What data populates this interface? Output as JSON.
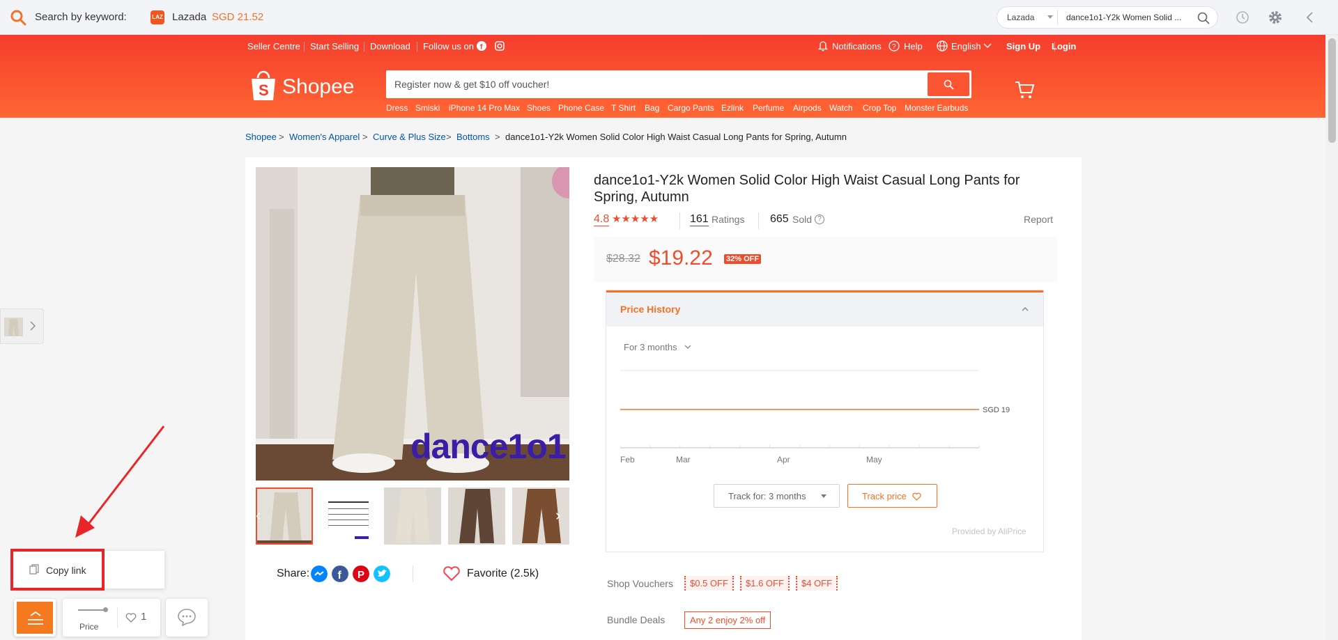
{
  "extension": {
    "search_label": "Search by keyword:",
    "lazada_icon_text": "LAZ",
    "lazada_name": "Lazada",
    "lazada_price": "SGD 21.52",
    "site_select": "Lazada",
    "query": "dance1o1-Y2k Women Solid ...",
    "accent": "#f57224"
  },
  "topnav": {
    "seller_centre": "Seller Centre",
    "start_selling": "Start Selling",
    "download": "Download",
    "follow_us": "Follow us on",
    "notifications": "Notifications",
    "help": "Help",
    "language": "English",
    "sign_up": "Sign Up",
    "login": "Login"
  },
  "header": {
    "logo_text": "Shopee",
    "search_placeholder": "Register now & get $10 off voucher!",
    "brand_color": "#ee4d2d",
    "keywords": [
      "Dress",
      "Smiski",
      "iPhone 14 Pro Max",
      "Shoes",
      "Phone Case",
      "T Shirt",
      "Bag",
      "Cargo Pants",
      "Ezlink",
      "Perfume",
      "Airpods",
      "Watch",
      "Crop Top",
      "Monster Earbuds"
    ]
  },
  "breadcrumb": [
    "Shopee",
    "Women's Apparel",
    "Curve & Plus Size",
    "Bottoms",
    "dance1o1-Y2k Women Solid Color High Waist Casual Long Pants for Spring, Autumn"
  ],
  "product": {
    "title": "dance1o1-Y2k Women Solid Color High Waist Casual Long Pants for Spring, Autumn",
    "rating": "4.8",
    "stars": "★★★★★",
    "ratings_count": "161",
    "ratings_label": "Ratings",
    "sold_count": "665",
    "sold_label": "Sold",
    "report": "Report",
    "old_price": "$28.32",
    "price": "$19.22",
    "discount": "32% OFF",
    "watermark": "dance1o1",
    "share_label": "Share:",
    "favorite": "Favorite (2.5k)"
  },
  "price_history": {
    "title": "Price History",
    "period": "For 3 months",
    "current_label": "SGD 19.22",
    "x_ticks": [
      "Feb",
      "Mar",
      "Apr",
      "May"
    ],
    "track_for": "Track for: 3 months",
    "track_price": "Track price",
    "provider": "Provided by AliPrice"
  },
  "chart_data": {
    "type": "line",
    "title": "Price History",
    "xlabel": "",
    "ylabel": "",
    "categories": [
      "Feb",
      "Mar",
      "Apr",
      "May"
    ],
    "series": [
      {
        "values": [
          19.22,
          19.22,
          19.22,
          19.22
        ]
      }
    ],
    "annotations": [
      "SGD 19.22"
    ],
    "grid": true
  },
  "vouchers": {
    "label": "Shop Vouchers",
    "items": [
      "$0.5 OFF",
      "$1.6 OFF",
      "$4 OFF"
    ]
  },
  "bundle": {
    "label": "Bundle Deals",
    "tag": "Any 2 enjoy 2% off"
  },
  "widgets": {
    "copy_link": "Copy link",
    "price_label": "Price",
    "favorites_count": "1"
  }
}
